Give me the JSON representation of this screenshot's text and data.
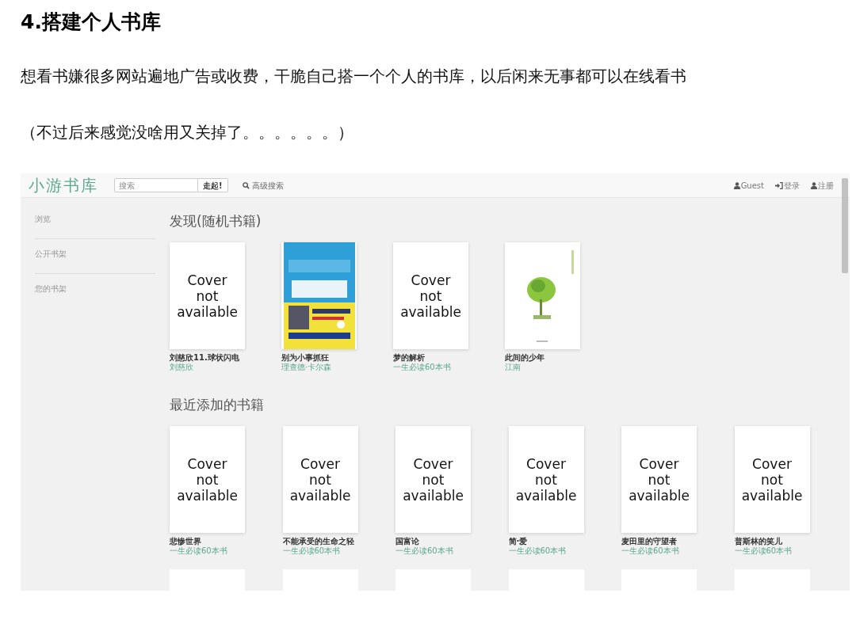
{
  "article": {
    "heading": "4.搭建个人书库",
    "paragraphs": [
      "想看书嫌很多网站遍地广告或收费，干脆自己搭一个个人的书库，以后闲来无事都可以在线看书",
      "（不过后来感觉没啥用又关掉了。。。。。。）"
    ]
  },
  "app": {
    "logo": "小游书库",
    "search": {
      "placeholder": "搜索",
      "button": "走起!"
    },
    "advanced_search": "高级搜索",
    "nav_right": [
      {
        "kind": "user",
        "label": "Guest"
      },
      {
        "kind": "login",
        "label": "登录"
      },
      {
        "kind": "user",
        "label": "注册"
      }
    ],
    "sidebar": [
      "浏览",
      "公开书架",
      "您的书架"
    ],
    "sections": [
      {
        "title": "发现(随机书籍)",
        "books": [
          {
            "title": "刘慈欣11.球状闪电",
            "author": "刘慈欣",
            "cover": {
              "kind": "placeholder",
              "text": "Cover\nnot\navailable"
            }
          },
          {
            "title": "别为小事抓狂",
            "author": "理查德·卡尔森"
          },
          {
            "title": "梦的解析",
            "author": "一生必读60本书",
            "cover": {
              "kind": "placeholder",
              "text": "Cover\nnot\navailable"
            }
          },
          {
            "title": "此间的少年",
            "author": "江南"
          }
        ]
      },
      {
        "title": "最近添加的书籍",
        "books": [
          {
            "title": "悲惨世界",
            "author": "一生必读60本书",
            "cover": {
              "kind": "placeholder",
              "text": "Cover\nnot\navailable"
            }
          },
          {
            "title": "不能承受的生命之轻",
            "author": "一生必读60本书",
            "cover": {
              "kind": "placeholder",
              "text": "Cover\nnot\navailable"
            }
          },
          {
            "title": "国富论",
            "author": "一生必读60本书",
            "cover": {
              "kind": "placeholder",
              "text": "Cover\nnot\navailable"
            }
          },
          {
            "title": "简·爱",
            "author": "一生必读60本书",
            "cover": {
              "kind": "placeholder",
              "text": "Cover\nnot\navailable"
            }
          },
          {
            "title": "麦田里的守望者",
            "author": "一生必读60本书",
            "cover": {
              "kind": "placeholder",
              "text": "Cover\nnot\navailable"
            }
          },
          {
            "title": "普斯林的笑儿",
            "author": "一生必读60本书",
            "cover": {
              "kind": "placeholder",
              "text": "Cover\nnot\navailable"
            }
          }
        ]
      }
    ],
    "partial_row": [
      {
        "kind": "blank"
      },
      {
        "kind": "blank"
      },
      {
        "kind": "blank"
      },
      {
        "kind": "blank"
      },
      {
        "kind": "blank"
      },
      {
        "kind": "blank"
      }
    ]
  }
}
